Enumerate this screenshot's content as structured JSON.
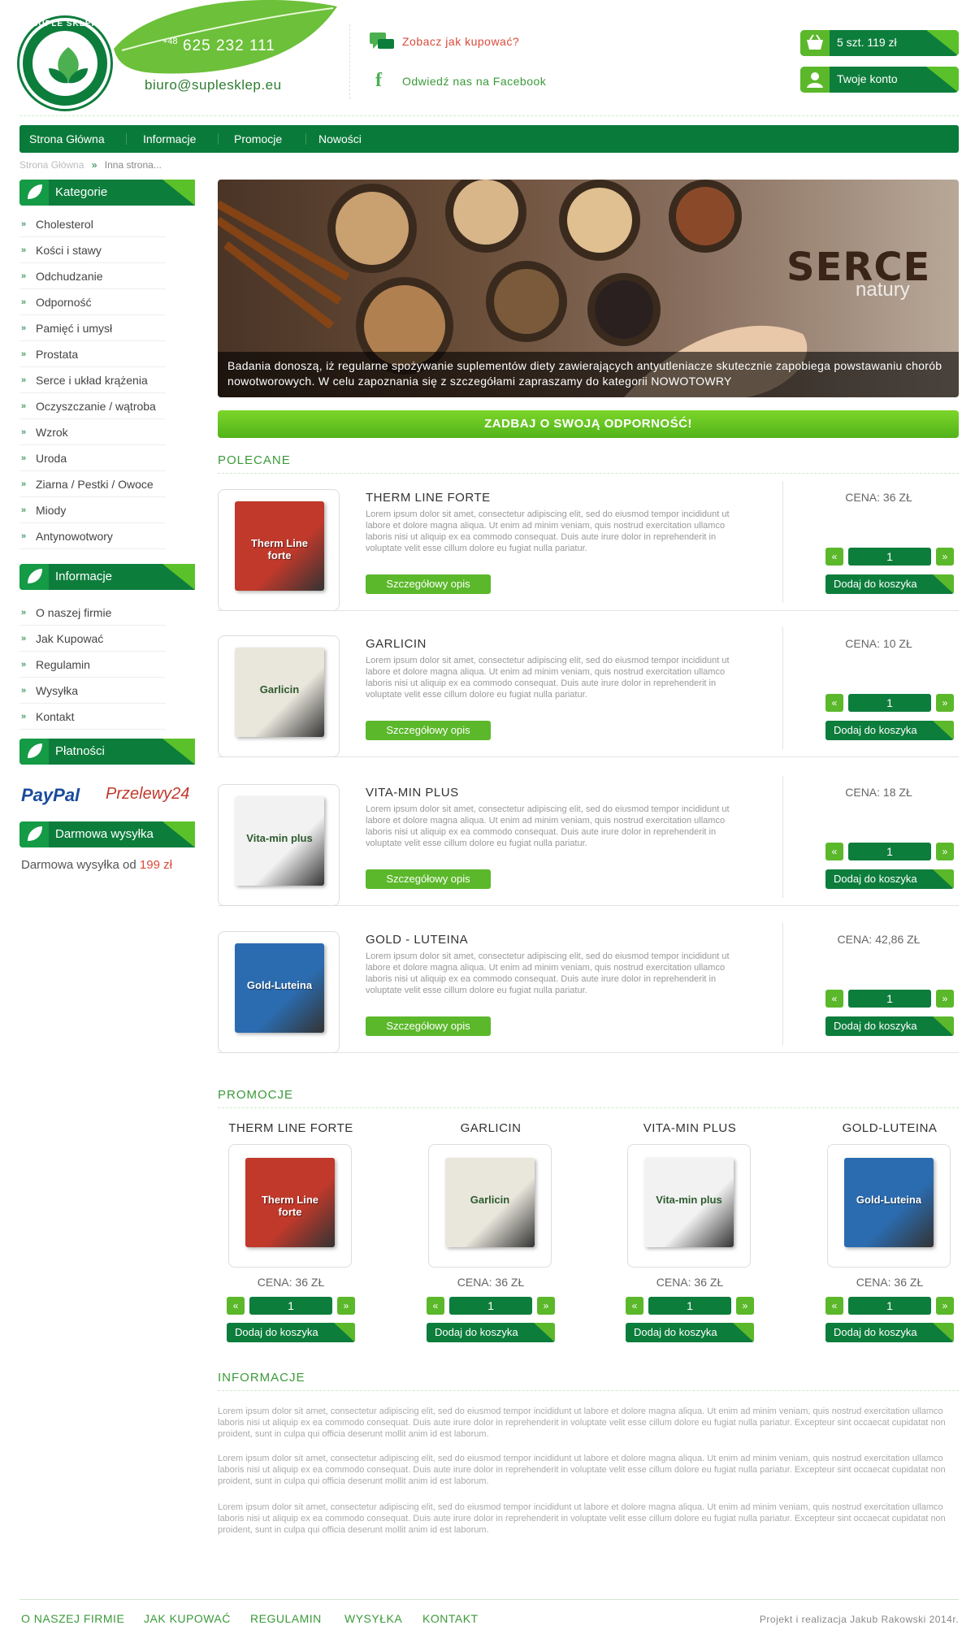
{
  "header": {
    "logo_text": "SUPLE SKLEP",
    "phone_prefix": "+48",
    "phone": "625 232 111",
    "email": "biuro@suplesklep.eu",
    "how_to_buy": "Zobacz jak kupować?",
    "facebook": "Odwiedź nas na Facebook",
    "cart": "5 szt. 119 zł",
    "account": "Twoje konto"
  },
  "nav": [
    "Strona Główna",
    "Informacje",
    "Promocje",
    "Nowości"
  ],
  "breadcrumb": {
    "home": "Strona Główna",
    "sep": "»",
    "current": "Inna strona..."
  },
  "sidebar": {
    "categories_title": "Kategorie",
    "categories": [
      "Cholesterol",
      "Kości i stawy",
      "Odchudzanie",
      "Odporność",
      "Pamięć i umysł",
      "Prostata",
      "Serce i układ krążenia",
      "Oczyszczanie / wątroba",
      "Wzrok",
      "Uroda",
      "Ziarna / Pestki / Owoce",
      "Miody",
      "Antynowotwory"
    ],
    "info_title": "Informacje",
    "info": [
      "O naszej firmie",
      "Jak Kupować",
      "Regulamin",
      "Wysyłka",
      "Kontakt"
    ],
    "payments_title": "Płatności",
    "paypal": "PayPal",
    "przelewy": "Przelewy24",
    "shipping_title": "Darmowa wysyłka",
    "shipping_text": "Darmowa wysyłka od",
    "shipping_amount": "199 zł"
  },
  "banner": {
    "title": "SERCE",
    "subtitle": "natury",
    "caption": "Badania donoszą, iż regularne spożywanie suplementów diety zawierających antyutleniacze skutecznie zapobiega powstawaniu chorób nowotworowych. W celu zapoznania się z szczegółami zapraszamy do kategorii NOWOTOWRY"
  },
  "cta": "ZADBAJ O SWOJĄ ODPORNOŚĆ!",
  "recommended": {
    "heading": "POLECANE",
    "detail_label": "Szczegółowy opis",
    "add_label": "Dodaj do koszyka",
    "prev": "«",
    "next": "»",
    "lorem": "Lorem ipsum dolor sit amet, consectetur adipiscing elit, sed do eiusmod tempor incididunt ut labore et dolore magna aliqua. Ut enim ad minim veniam, quis nostrud exercitation ullamco laboris nisi ut aliquip ex ea commodo consequat. Duis aute irure dolor in reprehenderit in voluptate velit esse cillum dolore eu fugiat nulla pariatur.",
    "items": [
      {
        "name": "THERM LINE FORTE",
        "price": "CENA: 36 ZŁ",
        "qty": "1",
        "box": "Therm Line forte",
        "color": "#c0392b"
      },
      {
        "name": "GARLICIN",
        "price": "CENA: 10 ZŁ",
        "qty": "1",
        "box": "Garlicin",
        "color": "#e9e6dc"
      },
      {
        "name": "VITA-MIN PLUS",
        "price": "CENA: 18 ZŁ",
        "qty": "1",
        "box": "Vita-min plus",
        "color": "#f2f2f2"
      },
      {
        "name": "GOLD - LUTEINA",
        "price": "CENA: 42,86 ZŁ",
        "qty": "1",
        "box": "Gold-Luteina",
        "color": "#2b6cb0"
      }
    ]
  },
  "promos": {
    "heading": "PROMOCJE",
    "items": [
      {
        "name": "THERM LINE FORTE",
        "price": "CENA: 36 ZŁ",
        "qty": "1",
        "box": "Therm Line forte",
        "color": "#c0392b"
      },
      {
        "name": "GARLICIN",
        "price": "CENA: 36 ZŁ",
        "qty": "1",
        "box": "Garlicin",
        "color": "#e9e6dc"
      },
      {
        "name": "VITA-MIN PLUS",
        "price": "CENA: 36 ZŁ",
        "qty": "1",
        "box": "Vita-min plus",
        "color": "#f2f2f2"
      },
      {
        "name": "GOLD-LUTEINA",
        "price": "CENA: 36 ZŁ",
        "qty": "1",
        "box": "Gold-Luteina",
        "color": "#2b6cb0"
      }
    ]
  },
  "information": {
    "heading": "INFORMACJE",
    "paragraph": "Lorem ipsum dolor sit amet, consectetur adipiscing elit, sed do eiusmod tempor incididunt ut labore et dolore magna aliqua. Ut enim ad minim veniam, quis nostrud exercitation ullamco laboris nisi ut aliquip ex ea commodo consequat. Duis aute irure dolor in reprehenderit in voluptate velit esse cillum dolore eu fugiat nulla pariatur. Excepteur sint occaecat cupidatat non proident, sunt in culpa qui officia deserunt mollit anim id est laborum."
  },
  "footer": {
    "links": [
      "O NASZEJ FIRMIE",
      "JAK KUPOWAĆ",
      "REGULAMIN",
      "WYSYŁKA",
      "KONTAKT"
    ],
    "credit": "Projekt i realizacja Jakub Rakowski 2014r."
  }
}
